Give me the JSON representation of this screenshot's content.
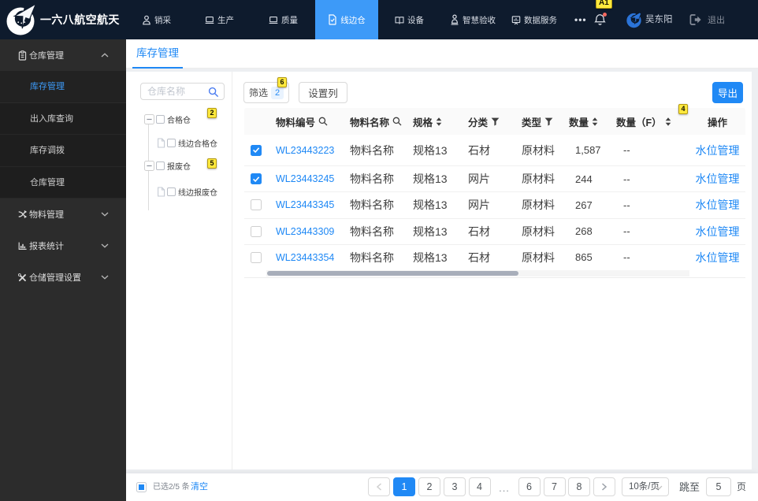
{
  "topbar": {
    "brand": "一六八航空航天",
    "nav": [
      {
        "label": "销采",
        "icon": "user-icon",
        "active": false
      },
      {
        "label": "生产",
        "icon": "laptop-icon",
        "active": false
      },
      {
        "label": "质量",
        "icon": "laptop-icon",
        "active": false
      },
      {
        "label": "线边仓",
        "icon": "file-check-icon",
        "active": true
      },
      {
        "label": "设备",
        "icon": "book-icon",
        "active": false
      },
      {
        "label": "智慧验收",
        "icon": "person-check-icon",
        "active": false
      },
      {
        "label": "数据服务",
        "icon": "data-board-icon",
        "active": false
      }
    ],
    "more_label": "•••",
    "notification_hint": "A1",
    "user_name": "吴东阳",
    "logout_label": "退出"
  },
  "sidebar": {
    "items": [
      {
        "label": "仓库管理",
        "icon": "clipboard-icon",
        "expanded": true,
        "children": [
          {
            "label": "库存管理",
            "active": true
          },
          {
            "label": "出入库查询",
            "active": false
          },
          {
            "label": "库存调拨",
            "active": false
          },
          {
            "label": "仓库管理",
            "active": false
          }
        ]
      },
      {
        "label": "物料管理",
        "icon": "shuffle-icon",
        "expanded": false,
        "children": []
      },
      {
        "label": "报表统计",
        "icon": "chart-icon",
        "expanded": false,
        "children": []
      },
      {
        "label": "仓储管理设置",
        "icon": "tools-icon",
        "expanded": false,
        "children": []
      }
    ]
  },
  "tabs": {
    "items": [
      {
        "label": "库存管理",
        "active": true
      }
    ]
  },
  "tree_panel": {
    "search_placeholder": "仓库名称",
    "nodes": [
      {
        "label": "合格仓",
        "hint": "2",
        "children": [
          {
            "label": "线边合格仓"
          }
        ]
      },
      {
        "label": "报废仓",
        "hint": "5",
        "children": [
          {
            "label": "线边报废仓"
          }
        ]
      }
    ]
  },
  "toolbar": {
    "filter_label": "筛选",
    "filter_count": "2",
    "filter_hint": "6",
    "columns_label": "设置列",
    "export_label": "导出"
  },
  "table": {
    "columns": [
      {
        "key": "check",
        "label": "",
        "icon": "none"
      },
      {
        "key": "code",
        "label": "物料编号",
        "icon": "search"
      },
      {
        "key": "name",
        "label": "物料名称",
        "icon": "search"
      },
      {
        "key": "spec",
        "label": "规格",
        "icon": "sort"
      },
      {
        "key": "category",
        "label": "分类",
        "icon": "filter"
      },
      {
        "key": "type",
        "label": "类型",
        "icon": "filter"
      },
      {
        "key": "qty",
        "label": "数量",
        "icon": "sort"
      },
      {
        "key": "qtyf",
        "label": "数量（F）",
        "icon": "sort",
        "hint": "4"
      },
      {
        "key": "action",
        "label": "操作",
        "icon": "none"
      }
    ],
    "rows": [
      {
        "checked": true,
        "code": "WL23443223",
        "name": "物料名称",
        "spec": "规格13",
        "category": "石材",
        "type": "原材料",
        "qty": "1,587",
        "qtyf": "--",
        "action": "水位管理"
      },
      {
        "checked": true,
        "code": "WL23443245",
        "name": "物料名称",
        "spec": "规格13",
        "category": "网片",
        "type": "原材料",
        "qty": "244",
        "qtyf": "--",
        "action": "水位管理"
      },
      {
        "checked": false,
        "code": "WL23443345",
        "name": "物料名称",
        "spec": "规格13",
        "category": "网片",
        "type": "原材料",
        "qty": "267",
        "qtyf": "--",
        "action": "水位管理"
      },
      {
        "checked": false,
        "code": "WL23443309",
        "name": "物料名称",
        "spec": "规格13",
        "category": "石材",
        "type": "原材料",
        "qty": "268",
        "qtyf": "--",
        "action": "水位管理"
      },
      {
        "checked": false,
        "code": "WL23443354",
        "name": "物料名称",
        "spec": "规格13",
        "category": "石材",
        "type": "原材料",
        "qty": "865",
        "qtyf": "--",
        "action": "水位管理"
      }
    ]
  },
  "footer": {
    "selected_text": "已选2/5 条",
    "clear_label": "清空",
    "pages": [
      "1",
      "2",
      "3",
      "4",
      "...",
      "6",
      "7",
      "8"
    ],
    "active_page": "1",
    "page_size": "10条/页",
    "jump_label": "跳至",
    "jump_value": "5",
    "page_unit": "页"
  }
}
